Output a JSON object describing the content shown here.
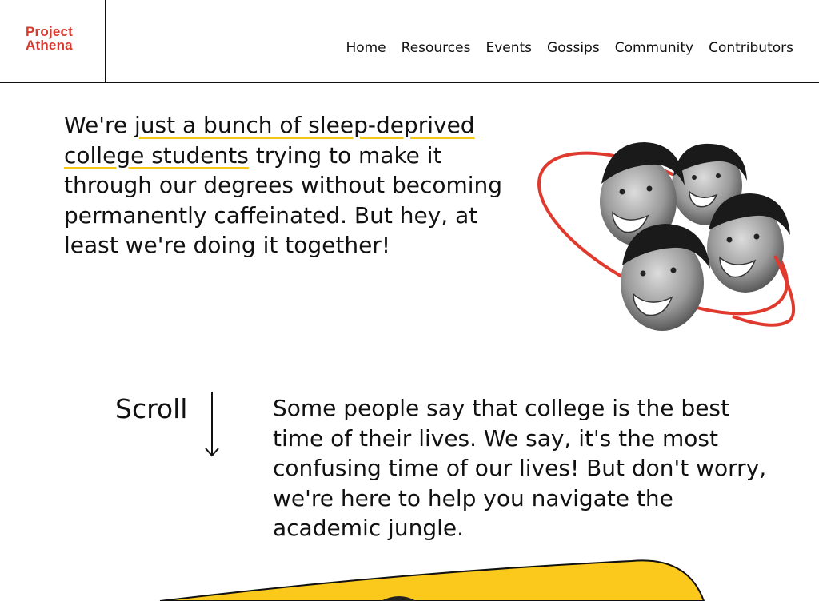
{
  "header": {
    "logo_line1": "Project",
    "logo_line2": "Athena",
    "nav": [
      "Home",
      "Resources",
      "Events",
      "Gossips",
      "Community",
      "Contributors"
    ]
  },
  "hero": {
    "intro": "We're ",
    "highlight": "just a bunch of sleep-deprived college students",
    "rest": " trying to make it through our degrees without becoming permanently caffeinated. But hey, at least we're doing it together!"
  },
  "scroll": {
    "label": "Scroll",
    "arrow_icon": "arrow-down-icon"
  },
  "intro_section": {
    "text": "Some people say that college is the best time of their lives. We say, it's the most confusing time of our lives! But don't worry, we're here to help you navigate the academic jungle."
  },
  "colors": {
    "brand_red": "#d63a2f",
    "highlight_yellow": "#f5c518",
    "ring_red": "#e03a2e",
    "band_yellow": "#fbc91c"
  }
}
